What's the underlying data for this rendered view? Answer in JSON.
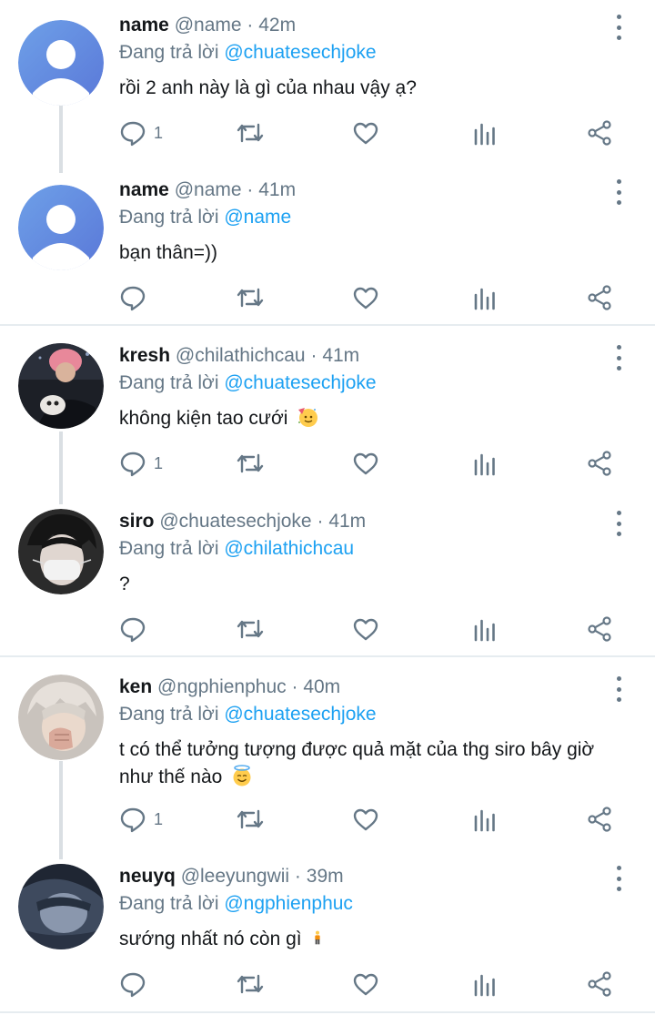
{
  "colors": {
    "mention": "#1da1f2",
    "muted": "#657786",
    "text": "#14171a",
    "divider": "#e6ecf0",
    "thread": "#dadfe3"
  },
  "reply_prefix": "Đang trả lời",
  "tweets": [
    {
      "name": "name",
      "handle": "@name",
      "time": "42m",
      "reply_to": "@chuatesechjoke",
      "text": "rồi 2 anh này là gì của nhau vậy ạ?",
      "reply_count": "1",
      "avatar": "default-avatar-icon"
    },
    {
      "name": "name",
      "handle": "@name",
      "time": "41m",
      "reply_to": "@name",
      "text": "bạn thân=))",
      "reply_count": "",
      "avatar": "default-avatar-icon"
    },
    {
      "name": "kresh",
      "handle": "@chilathichcau",
      "time": "41m",
      "reply_to": "@chuatesechjoke",
      "text": "không kiện tao cưới",
      "emoji": "partying-face-emoji",
      "reply_count": "1",
      "avatar": "photo-avatar"
    },
    {
      "name": "siro",
      "handle": "@chuatesechjoke",
      "time": "41m",
      "reply_to": "@chilathichcau",
      "text": "?",
      "reply_count": "",
      "avatar": "photo-avatar"
    },
    {
      "name": "ken",
      "handle": "@ngphienphuc",
      "time": "40m",
      "reply_to": "@chuatesechjoke",
      "text": "t có thể tưởng tượng được quả mặt của thg siro bây giờ như thế nào",
      "emoji": "smiling-face-with-halo-emoji",
      "reply_count": "1",
      "avatar": "photo-avatar"
    },
    {
      "name": "neuyq",
      "handle": "@leeyungwii",
      "time": "39m",
      "reply_to": "@ngphienphuc",
      "text": "sướng nhất nó còn gì",
      "emoji": "person-standing-emoji",
      "reply_count": "",
      "avatar": "photo-avatar"
    }
  ]
}
